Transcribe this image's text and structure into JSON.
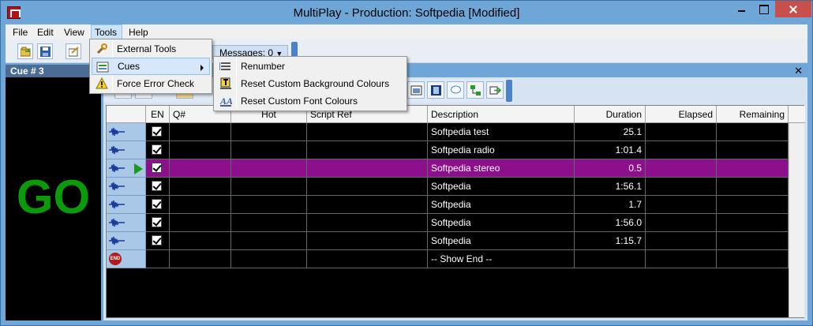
{
  "window": {
    "title": "MultiPlay - Production: Softpedia [Modified]"
  },
  "menubar": {
    "file": "File",
    "edit": "Edit",
    "view": "View",
    "tools": "Tools",
    "help": "Help"
  },
  "toolbar": {
    "messages_label": "Messages: 0"
  },
  "left_panel": {
    "header": "Cue # 3",
    "go_label": "GO"
  },
  "grid": {
    "columns": [
      "EN",
      "Q#",
      "Hot",
      "Script Ref",
      "Description",
      "Duration",
      "Elapsed",
      "Remaining"
    ],
    "rows": [
      {
        "description": "Softpedia test",
        "duration": "25.1",
        "enabled": true
      },
      {
        "description": "Softpedia radio",
        "duration": "1:01.4",
        "enabled": true
      },
      {
        "description": "Softpedia stereo",
        "duration": "0.5",
        "enabled": true,
        "selected": true,
        "playing": true
      },
      {
        "description": "Softpedia",
        "duration": "1:56.1",
        "enabled": true
      },
      {
        "description": "Softpedia",
        "duration": "1.7",
        "enabled": true
      },
      {
        "description": "Softpedia",
        "duration": "1:56.0",
        "enabled": true
      },
      {
        "description": "Softpedia",
        "duration": "1:15.7",
        "enabled": true
      },
      {
        "description": "-- Show End --",
        "duration": "",
        "enabled": false,
        "end": true,
        "end_badge": "END"
      }
    ]
  },
  "tools_menu": {
    "items": [
      "External Tools",
      "Cues",
      "Force Error Check"
    ]
  },
  "cues_submenu": {
    "items": [
      "Renumber",
      "Reset Custom Background Colours",
      "Reset Custom Font Colours"
    ]
  },
  "colors": {
    "selected_row": "#8c108c",
    "go_text": "#0a9a0a",
    "title_bar": "#6ea6d7"
  }
}
